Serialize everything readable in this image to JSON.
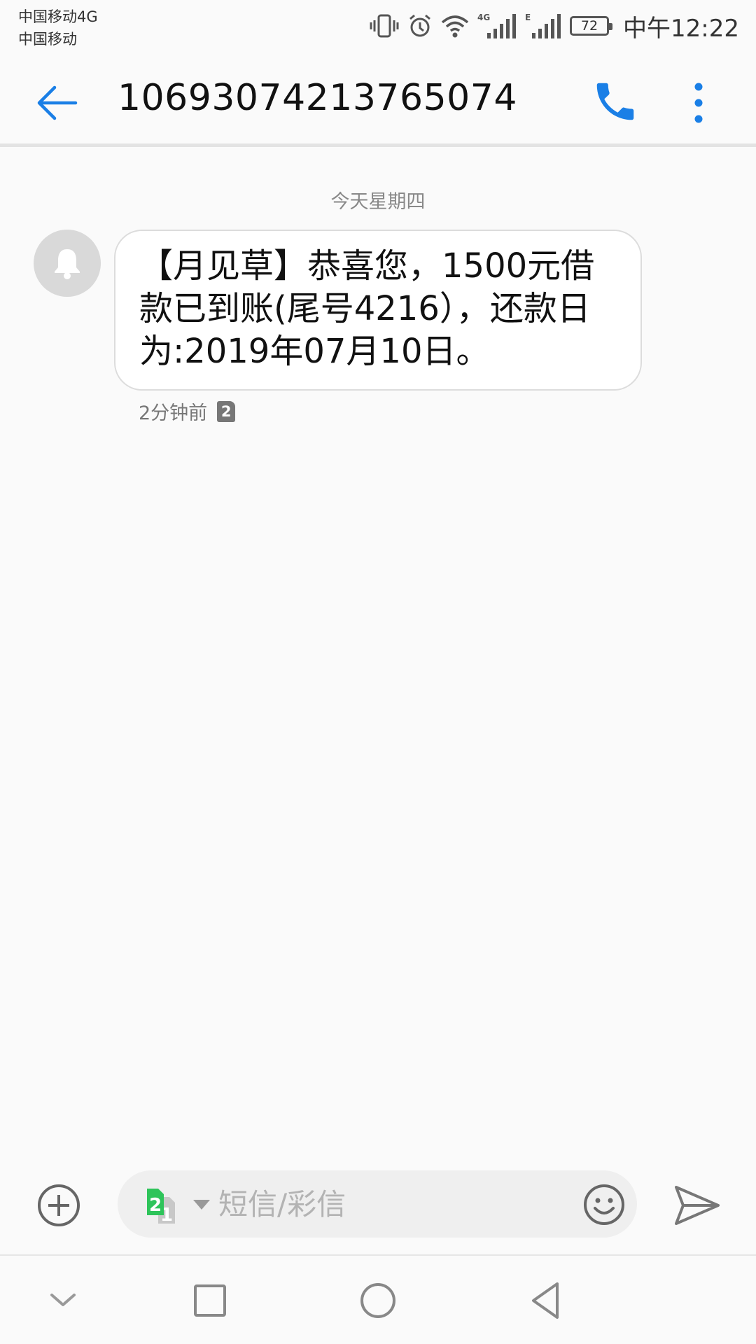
{
  "status_bar": {
    "carrier_1": "中国移动4G",
    "carrier_2": "中国移动",
    "network_1": "4G",
    "network_2": "E",
    "battery_level": "72",
    "time": "中午12:22",
    "icons": [
      "vibrate-icon",
      "alarm-icon",
      "wifi-icon",
      "signal-icon",
      "signal-icon",
      "battery-icon"
    ]
  },
  "header": {
    "title": "10693074213765074",
    "back_icon": "arrow-left-icon",
    "call_icon": "phone-icon",
    "more_icon": "more-vertical-icon",
    "accent_color": "#1a7fe6"
  },
  "conversation": {
    "date_separator": "今天星期四",
    "messages": [
      {
        "text": "【月见草】恭喜您，1500元借款已到账(尾号4216），还款日为:2019年07月10日。",
        "time": "2分钟前",
        "sim": "2",
        "avatar_icon": "bell-icon"
      }
    ]
  },
  "composer": {
    "placeholder": "短信/彩信",
    "value": "",
    "sim_front": "2",
    "sim_back": "1",
    "add_icon": "plus-circle-icon",
    "emoji_icon": "smiley-icon",
    "send_icon": "send-icon",
    "sim_color": "#2ec45a"
  },
  "nav_bar": {
    "icons": [
      "chevron-down-icon",
      "square-icon",
      "circle-icon",
      "triangle-back-icon"
    ]
  }
}
